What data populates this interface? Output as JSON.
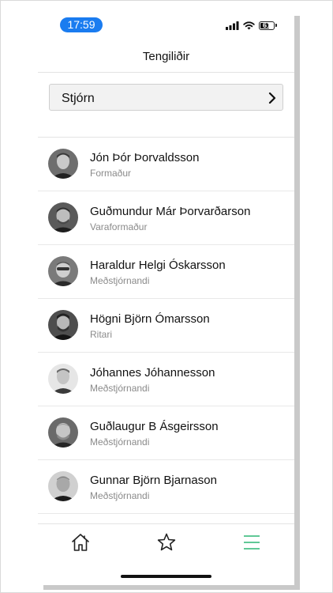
{
  "status_bar": {
    "time": "17:59",
    "battery_level": "61"
  },
  "header": {
    "title": "Tengiliðir"
  },
  "group_select": {
    "label": "Stjórn"
  },
  "members": [
    {
      "name": "Jón Þór Þorvaldsson",
      "role": "Formaður"
    },
    {
      "name": "Guðmundur Már Þorvarðarson",
      "role": "Varaformaður"
    },
    {
      "name": "Haraldur Helgi Óskarsson",
      "role": "Meðstjórnandi"
    },
    {
      "name": "Högni Björn Ómarsson",
      "role": "Ritari"
    },
    {
      "name": "Jóhannes Jóhannesson",
      "role": "Meðstjórnandi"
    },
    {
      "name": "Guðlaugur B Ásgeirsson",
      "role": "Meðstjórnandi"
    },
    {
      "name": "Gunnar Björn Bjarnason",
      "role": "Meðstjórnandi"
    }
  ],
  "tab_bar": {
    "tabs": [
      {
        "icon": "home-icon",
        "active": false
      },
      {
        "icon": "star-icon",
        "active": false
      },
      {
        "icon": "menu-icon",
        "active": true
      }
    ],
    "active_color": "#2bb673",
    "inactive_color": "#222222"
  },
  "colors": {
    "time_pill": "#1a7cf0"
  }
}
